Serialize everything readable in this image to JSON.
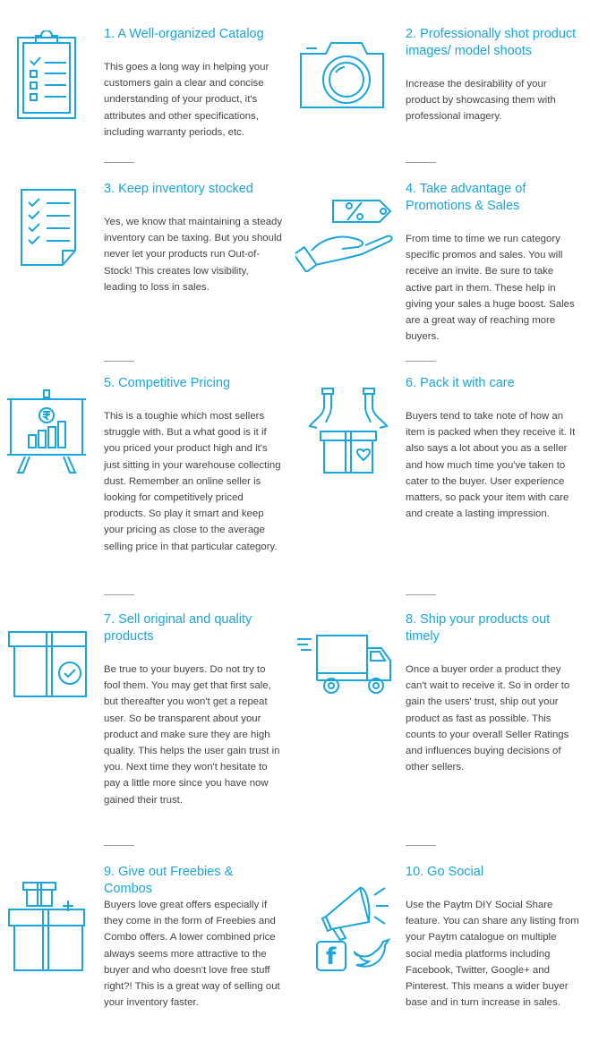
{
  "accent_color": "#1aa5dc",
  "items": [
    {
      "title": "1. A Well-organized Catalog",
      "desc": "This goes a long way in helping your customers gain a clear and concise understanding of your product, it's attributes and other specifications, including warranty periods, etc.",
      "icon": "clipboard-checklist-icon"
    },
    {
      "title": "2. Professionally shot product images/ model shoots",
      "desc": "Increase the desirability of your product by showcasing them with professional imagery.",
      "icon": "camera-icon"
    },
    {
      "title": "3. Keep inventory stocked",
      "desc": "Yes, we know that maintaining a steady inventory can be taxing. But you should never let your products run Out-of-Stock! This creates low visibility, leading to loss in sales.",
      "icon": "checklist-document-icon"
    },
    {
      "title": "4. Take advantage of Promotions & Sales",
      "desc": "From time to time we run category specific promos and sales. You will receive an invite. Be sure to take active part in them. These help in giving your sales a huge boost. Sales are a great way of reaching more buyers.",
      "icon": "hand-with-discount-tag-icon"
    },
    {
      "title": "5. Competitive Pricing",
      "desc": "This is a toughie which most sellers struggle with. But a what good is it if you priced your product high and it's just sitting in your warehouse collecting dust. Remember an online seller is looking for competitively priced products. So play it smart and keep your pricing as close to the average selling price in that particular category.",
      "icon": "rupee-bar-chart-easel-icon"
    },
    {
      "title": "6. Pack it with care",
      "desc": "Buyers tend to take note of how an item is packed when they receive it. It also says a lot about you as a seller and how much time you've taken to cater to the buyer. User experience matters, so pack your item with care and create a lasting impression.",
      "icon": "hands-gift-box-icon"
    },
    {
      "title": "7. Sell original and quality products",
      "desc": "Be true to your buyers. Do not try to fool them. You may get that first sale, but thereafter you won't get a repeat user. So be transparent about your product and make sure they are high quality. This helps the user gain trust in you. Next time they won't hesitate to pay a little more since you have now gained their trust.",
      "icon": "verified-box-icon"
    },
    {
      "title": "8. Ship your products out timely",
      "desc": "Once a buyer order a product they can't wait to receive it. So in order to gain the users' trust, ship out your product as fast as possible. This counts to your overall Seller Ratings and influences buying decisions of other sellers.",
      "icon": "delivery-truck-icon"
    },
    {
      "title": "9. Give out Freebies & Combos",
      "desc": "Buyers love great offers especially if they come in the form of Freebies and Combo offers. A lower combined price always seems more attractive to the buyer and who doesn't love free stuff right?! This is a great way of selling out your inventory faster.",
      "icon": "stacked-gift-boxes-icon"
    },
    {
      "title": "10. Go Social",
      "desc": "Use the Paytm DIY Social Share feature. You can share any listing from your Paytm catalogue on multiple social media platforms including Facebook, Twitter, Google+ and Pinterest. This means a wider buyer base and in turn increase in sales.",
      "icon": "megaphone-social-icon"
    }
  ],
  "social_icon_text": {
    "facebook": "f"
  }
}
